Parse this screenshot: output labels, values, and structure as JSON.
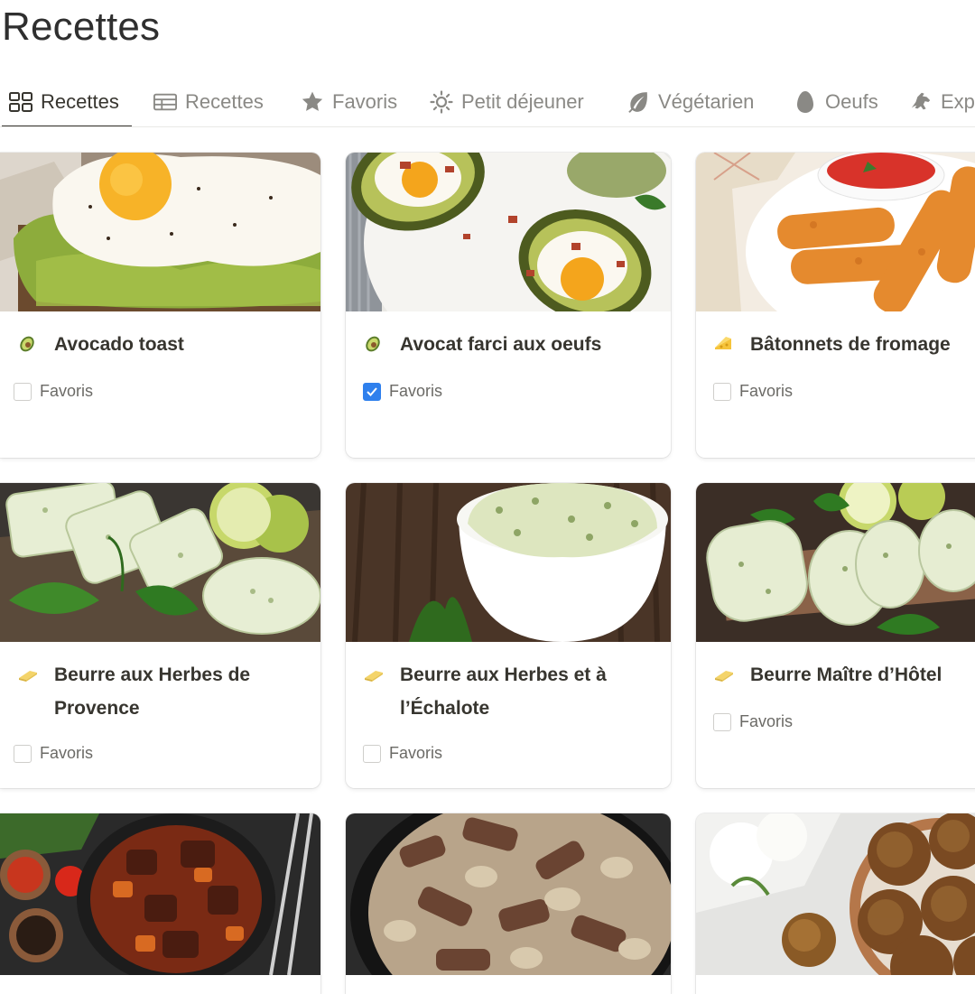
{
  "page": {
    "title": "Recettes"
  },
  "tabs": [
    {
      "label": "Recettes",
      "icon": "gallery-icon",
      "active": true
    },
    {
      "label": "Recettes",
      "icon": "table-icon",
      "active": false
    },
    {
      "label": "Favoris",
      "icon": "star-icon",
      "active": false
    },
    {
      "label": "Petit déjeuner",
      "icon": "sun-icon",
      "active": false
    },
    {
      "label": "Végétarien",
      "icon": "leaf-icon",
      "active": false
    },
    {
      "label": "Oeufs",
      "icon": "egg-icon",
      "active": false
    },
    {
      "label": "Exp",
      "icon": "dragon-icon",
      "active": false
    }
  ],
  "cards": [
    {
      "name": "Avocado toast",
      "icon": "avocado-icon",
      "favoris_label": "Favoris",
      "favoris": false,
      "image": "avocado-toast-with-fried-egg-photo"
    },
    {
      "name": "Avocat farci aux oeufs",
      "icon": "avocado-icon",
      "favoris_label": "Favoris",
      "favoris": true,
      "image": "baked-eggs-in-avocado-photo"
    },
    {
      "name": "Bâtonnets de fromage",
      "icon": "cheese-icon",
      "favoris_label": "Favoris",
      "favoris": false,
      "image": "mozzarella-sticks-with-sauce-photo"
    },
    {
      "name": "Beurre aux Herbes de Provence",
      "icon": "butter-icon",
      "favoris_label": "Favoris",
      "favoris": false,
      "image": "herb-butter-slices-photo"
    },
    {
      "name": "Beurre aux Herbes et à l’Échalote",
      "icon": "butter-icon",
      "favoris_label": "Favoris",
      "favoris": false,
      "image": "herb-butter-bowl-photo"
    },
    {
      "name": "Beurre Maître d’Hôtel",
      "icon": "butter-icon",
      "favoris_label": "Favoris",
      "favoris": false,
      "image": "maitre-d-butter-log-photo"
    },
    {
      "name": "",
      "icon": "",
      "image": "beef-stew-pot-photo"
    },
    {
      "name": "",
      "icon": "",
      "image": "beef-stroganoff-mushrooms-photo"
    },
    {
      "name": "",
      "icon": "",
      "image": "falafel-balls-photo"
    }
  ],
  "colors": {
    "accent": "#2f80ed",
    "text": "#37352f",
    "muted": "#8a8985"
  }
}
